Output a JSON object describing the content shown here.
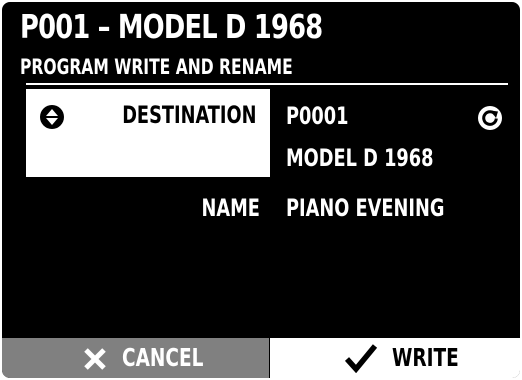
{
  "header": {
    "title": "P001 – MODEL D 1968",
    "subtitle": "PROGRAM WRITE AND RENAME"
  },
  "destination": {
    "label": "DESTINATION",
    "program_number": "P0001",
    "program_name": "MODEL D 1968",
    "selector_icon": "up-down-arrows-icon",
    "reset_icon": "refresh-icon"
  },
  "name_field": {
    "label": "NAME",
    "value": "PIANO EVENING"
  },
  "footer": {
    "cancel_label": "CANCEL",
    "cancel_icon": "close-icon",
    "write_label": "WRITE",
    "write_icon": "checkmark-icon"
  },
  "colors": {
    "panel_background": "#000000",
    "cancel_background": "#808080",
    "write_background": "#ffffff",
    "selection_background": "#ffffff"
  }
}
